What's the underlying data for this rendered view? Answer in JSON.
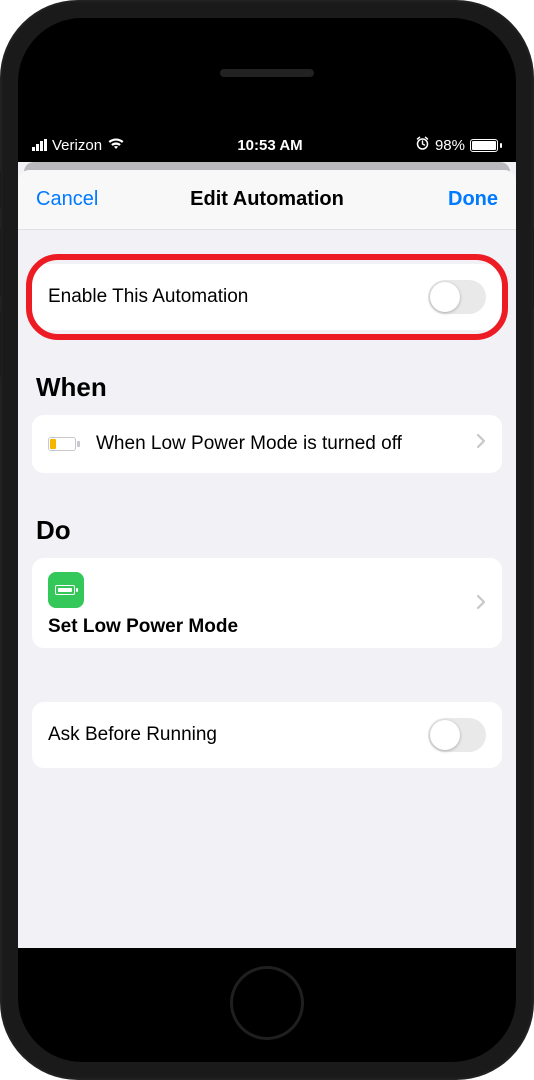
{
  "status_bar": {
    "carrier": "Verizon",
    "time": "10:53 AM",
    "battery_percent": "98%"
  },
  "nav": {
    "cancel": "Cancel",
    "title": "Edit Automation",
    "done": "Done"
  },
  "enable": {
    "label": "Enable This Automation",
    "on": false
  },
  "sections": {
    "when_title": "When",
    "when_desc": "When Low Power Mode is turned off",
    "do_title": "Do",
    "do_action": "Set Low Power Mode"
  },
  "ask": {
    "label": "Ask Before Running",
    "on": false
  }
}
